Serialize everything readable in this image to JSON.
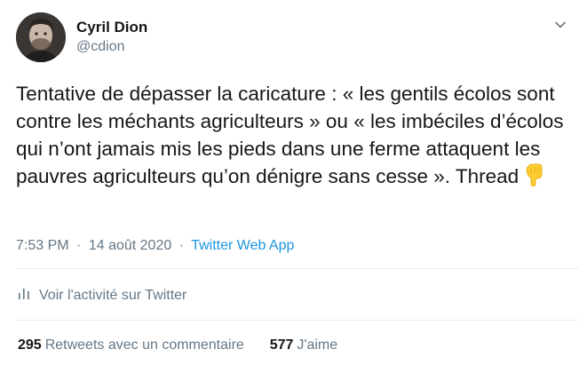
{
  "author": {
    "name": "Cyril Dion",
    "handle": "@cdion"
  },
  "tweet": {
    "text": "Tentative de dépasser la caricature : « les gentils écolos sont contre les méchants agriculteurs » ou « les imbéciles d’écolos qui n’ont jamais mis les pieds dans une ferme attaquent les pauvres agriculteurs qu’on dénigre sans cesse ». Thread",
    "emoji": "backhand-index-pointing-down"
  },
  "meta": {
    "time": "7:53 PM",
    "separator": "·",
    "date": "14 août 2020",
    "app": "Twitter Web App"
  },
  "activity": {
    "label": "Voir l'activité sur Twitter"
  },
  "stats": {
    "retweets_count": "295",
    "retweets_label": "Retweets avec un commentaire",
    "likes_count": "577",
    "likes_label": "J'aime"
  },
  "colors": {
    "text": "#14171a",
    "muted": "#657786",
    "link": "#1b95e0",
    "divider": "#e6ecf0"
  }
}
